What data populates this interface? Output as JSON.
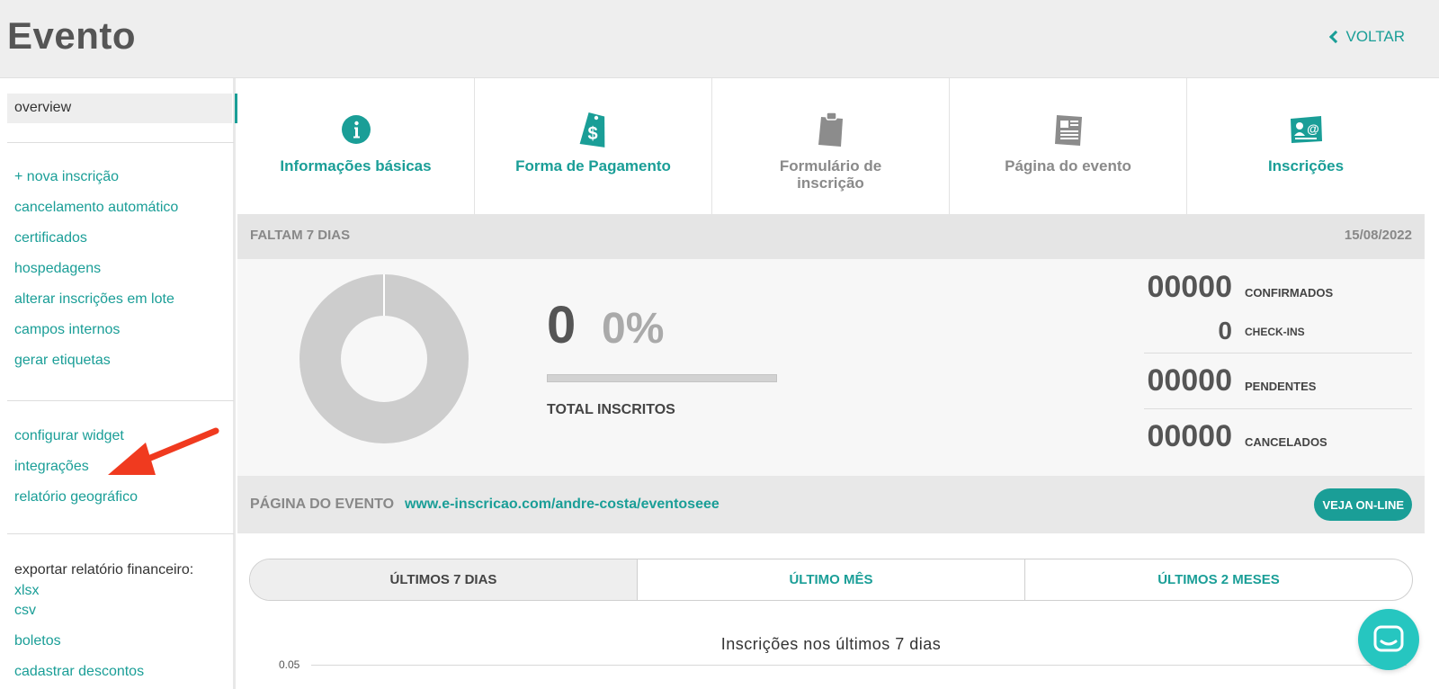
{
  "header": {
    "title": "Evento",
    "back_label": "VOLTAR"
  },
  "sidebar": {
    "overview": "overview",
    "group1": [
      "+ nova inscrição",
      "cancelamento automático",
      "certificados",
      "hospedagens",
      "alterar inscrições em lote",
      "campos internos",
      "gerar etiquetas"
    ],
    "group2": [
      "configurar widget",
      "integrações",
      "relatório geográfico"
    ],
    "export_label": "exportar relatório financeiro:",
    "export_links": [
      "xlsx",
      "csv"
    ],
    "group3": [
      "boletos",
      "cadastrar descontos"
    ]
  },
  "tiles": [
    {
      "label": "Informações básicas",
      "icon": "info-icon",
      "state": "done"
    },
    {
      "label": "Forma de Pagamento",
      "icon": "price-tag-icon",
      "state": "done"
    },
    {
      "label": "Formulário de inscrição",
      "icon": "clipboard-icon",
      "state": "pending"
    },
    {
      "label": "Página do evento",
      "icon": "newspaper-icon",
      "state": "pending"
    },
    {
      "label": "Inscrições",
      "icon": "contact-card-icon",
      "state": "done"
    }
  ],
  "countdown": {
    "remaining": "FALTAM 7 DIAS",
    "date": "15/08/2022"
  },
  "stats": {
    "total": "0",
    "percent": "0%",
    "progress": 0,
    "total_label": "TOTAL INSCRITOS",
    "counts": [
      {
        "value": "00000",
        "label": "CONFIRMADOS"
      },
      {
        "value": "0",
        "label": "CHECK-INS"
      },
      {
        "value": "00000",
        "label": "PENDENTES"
      },
      {
        "value": "00000",
        "label": "CANCELADOS"
      }
    ]
  },
  "event_page": {
    "label": "PÁGINA DO EVENTO",
    "url": "www.e-inscricao.com/andre-costa/eventoseee",
    "button": "VEJA ON-LINE"
  },
  "period_tabs": [
    "ÚLTIMOS 7 DIAS",
    "ÚLTIMO MÊS",
    "ÚLTIMOS 2 MESES"
  ],
  "chart": {
    "title": "Inscrições nos últimos 7 dias",
    "tick": "0.05"
  },
  "colors": {
    "accent": "#1a9e97",
    "muted": "#8a8a8a",
    "arrow": "#f03a1f",
    "chat": "#26c6c0"
  }
}
